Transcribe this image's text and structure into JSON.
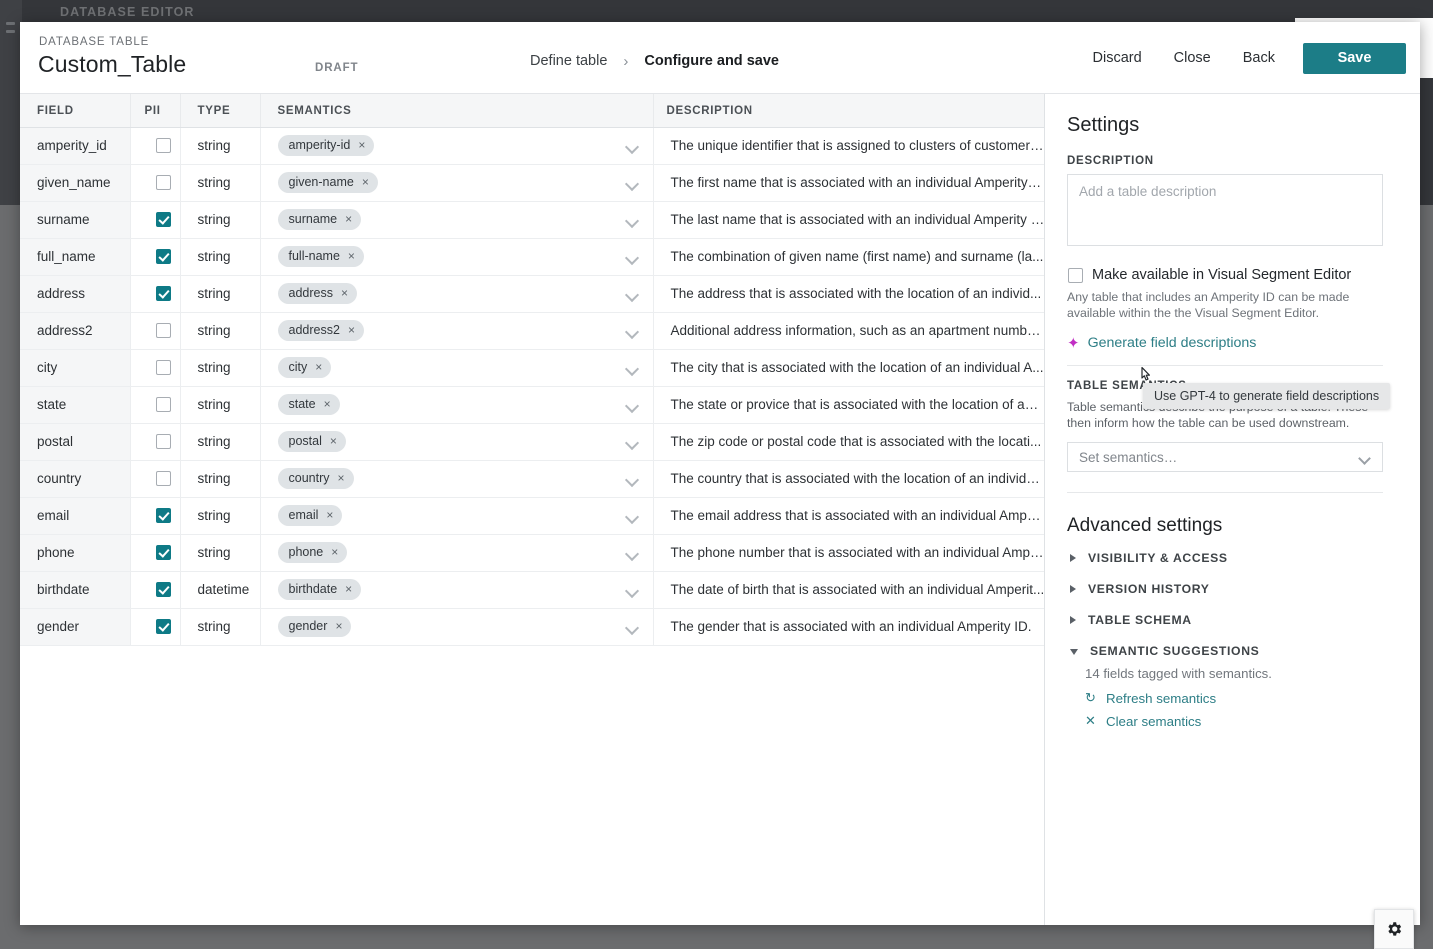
{
  "background": {
    "app_label": "DATABASE EDITOR"
  },
  "header": {
    "eyebrow": "DATABASE TABLE",
    "title": "Custom_Table",
    "status_badge": "DRAFT",
    "breadcrumbs": [
      {
        "label": "Define table",
        "active": false
      },
      {
        "label": "Configure and save",
        "active": true
      }
    ],
    "breadcrumb_separator": "›",
    "actions": [
      "Discard",
      "Close",
      "Back"
    ],
    "save_label": "Save",
    "save_color": "#1c7d87"
  },
  "table": {
    "columns": [
      "FIELD",
      "PII",
      "TYPE",
      "SEMANTICS",
      "DESCRIPTION"
    ],
    "rows": [
      {
        "field": "amperity_id",
        "pii": false,
        "type": "string",
        "semantic": "amperity-id",
        "description": "The unique identifier that is assigned to clusters of customer ..."
      },
      {
        "field": "given_name",
        "pii": false,
        "type": "string",
        "semantic": "given-name",
        "description": "The first name that is associated with an individual Amperity I..."
      },
      {
        "field": "surname",
        "pii": true,
        "type": "string",
        "semantic": "surname",
        "description": "The last name that is associated with an individual Amperity I..."
      },
      {
        "field": "full_name",
        "pii": true,
        "type": "string",
        "semantic": "full-name",
        "description": "The combination of given name (first name) and surname (la..."
      },
      {
        "field": "address",
        "pii": true,
        "type": "string",
        "semantic": "address",
        "description": "The address that is associated with the location of an individ..."
      },
      {
        "field": "address2",
        "pii": false,
        "type": "string",
        "semantic": "address2",
        "description": "Additional address information, such as an apartment numbe..."
      },
      {
        "field": "city",
        "pii": false,
        "type": "string",
        "semantic": "city",
        "description": "The city that is associated with the location of an individual A..."
      },
      {
        "field": "state",
        "pii": false,
        "type": "string",
        "semantic": "state",
        "description": "The state or provice that is associated with the location of an ..."
      },
      {
        "field": "postal",
        "pii": false,
        "type": "string",
        "semantic": "postal",
        "description": "The zip code or postal code that is associated with the locati..."
      },
      {
        "field": "country",
        "pii": false,
        "type": "string",
        "semantic": "country",
        "description": "The country that is associated with the location of an individu..."
      },
      {
        "field": "email",
        "pii": true,
        "type": "string",
        "semantic": "email",
        "description": "The email address that is associated with an individual Ampe..."
      },
      {
        "field": "phone",
        "pii": true,
        "type": "string",
        "semantic": "phone",
        "description": "The phone number that is associated with an individual Ampe..."
      },
      {
        "field": "birthdate",
        "pii": true,
        "type": "datetime",
        "semantic": "birthdate",
        "description": "The date of birth that is associated with an individual Amperit..."
      },
      {
        "field": "gender",
        "pii": true,
        "type": "string",
        "semantic": "gender",
        "description": "The gender that is associated with an individual Amperity ID."
      }
    ],
    "chip_remove_glyph": "×"
  },
  "settings": {
    "title": "Settings",
    "description_label": "DESCRIPTION",
    "description_value": "",
    "description_placeholder": "Add a table description",
    "vse_checkbox_label": "Make available in Visual Segment Editor",
    "vse_checked": false,
    "vse_help": "Any table that includes an Amperity ID can be made available within the the Visual Segment Editor.",
    "generate_link": "Generate field descriptions",
    "generate_tooltip": "Use GPT-4 to generate field descriptions",
    "table_semantics_label": "TABLE SEMANTICS",
    "table_semantics_help": "Table semantics describe the purpose of a table. These then inform how the table can be used downstream.",
    "semantics_select_value": "Set semantics…",
    "advanced_title": "Advanced settings",
    "accordions": [
      {
        "label": "VISIBILITY & ACCESS",
        "open": false
      },
      {
        "label": "VERSION HISTORY",
        "open": false
      },
      {
        "label": "TABLE SCHEMA",
        "open": false
      },
      {
        "label": "SEMANTIC SUGGESTIONS",
        "open": true
      }
    ],
    "suggestions": {
      "count_text": "14 fields tagged with semantics.",
      "refresh_label": "Refresh semantics",
      "clear_label": "Clear semantics",
      "refresh_icon": "↻",
      "clear_icon": "✕"
    },
    "link_color": "#2d7e86",
    "bolt_color": "#c12ec4"
  },
  "fab": {
    "icon": "gear-icon"
  }
}
